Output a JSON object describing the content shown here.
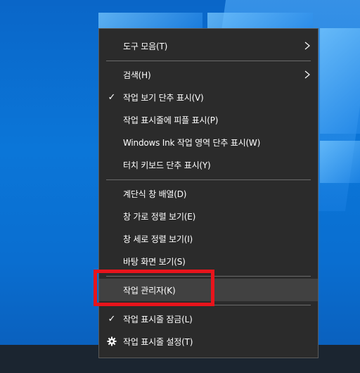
{
  "colors": {
    "menu_background": "#2b2b2b",
    "menu_hover": "#414141",
    "highlight_box": "#e8141c",
    "desktop_accent": "#0a6ed0",
    "taskbar": "#1b2530"
  },
  "context_menu": {
    "items": [
      {
        "label": "도구 모음(T)",
        "submenu": true,
        "checked": false
      },
      {
        "label": "검색(H)",
        "submenu": true,
        "checked": false
      },
      {
        "label": "작업 보기 단추 표시(V)",
        "submenu": false,
        "checked": true
      },
      {
        "label": "작업 표시줄에 피플 표시(P)",
        "submenu": false,
        "checked": false
      },
      {
        "label": "Windows Ink 작업 영역 단추 표시(W)",
        "submenu": false,
        "checked": false
      },
      {
        "label": "터치 키보드 단추 표시(Y)",
        "submenu": false,
        "checked": false
      },
      {
        "label": "계단식 창 배열(D)",
        "submenu": false,
        "checked": false
      },
      {
        "label": "창 가로 정렬 보기(E)",
        "submenu": false,
        "checked": false
      },
      {
        "label": "창 세로 정렬 보기(I)",
        "submenu": false,
        "checked": false
      },
      {
        "label": "바탕 화면 보기(S)",
        "submenu": false,
        "checked": false
      },
      {
        "label": "작업 관리자(K)",
        "submenu": false,
        "checked": false,
        "hovered": true
      },
      {
        "label": "작업 표시줄 잠금(L)",
        "submenu": false,
        "checked": true
      },
      {
        "label": "작업 표시줄 설정(T)",
        "submenu": false,
        "checked": false,
        "icon": "gear-icon"
      }
    ],
    "check_glyph": "✓"
  }
}
